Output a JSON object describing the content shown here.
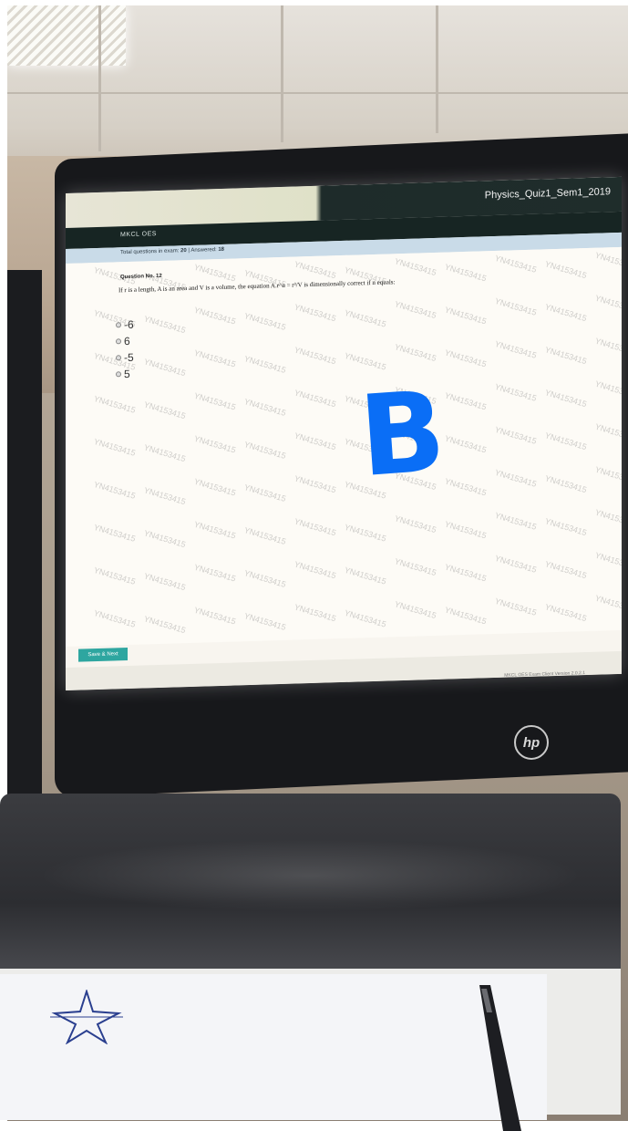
{
  "screen": {
    "exam_title": "Physics_Quiz1_Sem1_2019",
    "brand": "MKCL OES",
    "status": {
      "total_label": "Total questions in exam:",
      "total_value": "20",
      "separator": "|",
      "answered_label": "Answered:",
      "answered_value": "18"
    },
    "question_number": "Question No. 12",
    "question_text": "If r is a length, A is an area and V is a volume, the equation A.r^n = r³/V is dimensionally correct if n equals:",
    "options": [
      "-6",
      "6",
      "-5",
      "5"
    ],
    "watermark": "YN4153415",
    "save_next_label": "Save & Next",
    "footer_text": "MKCL OES Exam Client Version 2.0.2.1"
  },
  "handwritten_answer": "B",
  "monitor_logo": "hp",
  "colors": {
    "answer_ink": "#0a6ef6",
    "save_button": "#2ea6a0",
    "header_dark": "#1e2b2a",
    "status_bar": "#c9dbe8"
  }
}
